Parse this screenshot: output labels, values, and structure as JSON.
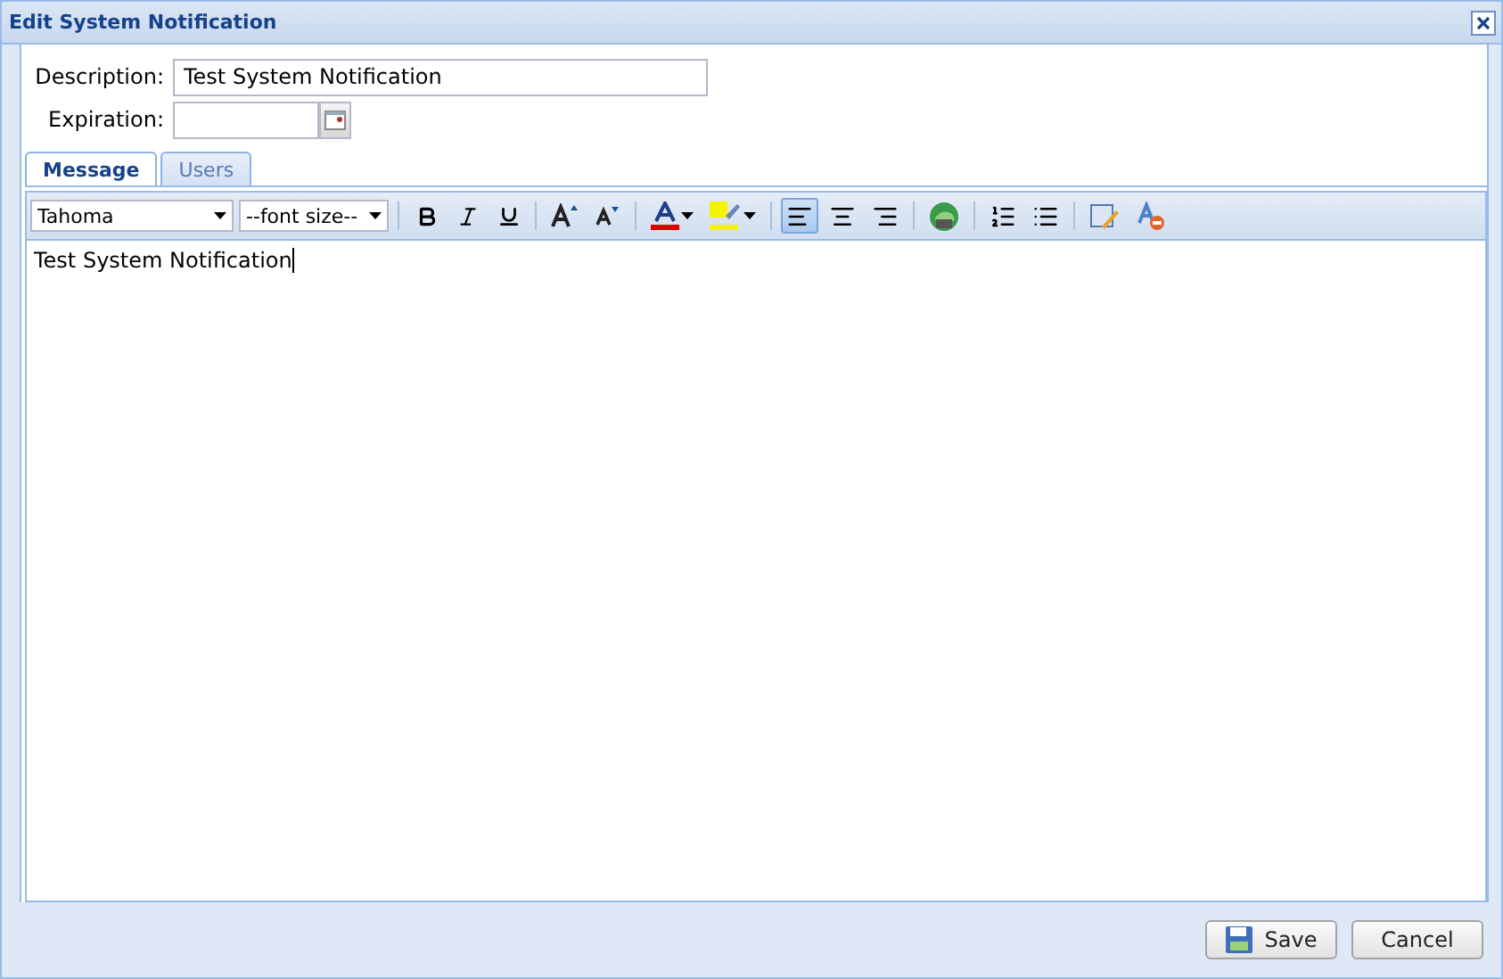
{
  "window": {
    "title": "Edit System Notification"
  },
  "fields": [
    {
      "label": "Description:",
      "value": "Test System Notification",
      "kind": "text"
    },
    {
      "label": "Expiration:",
      "kind": "date"
    }
  ],
  "tabs": [
    {
      "label": "Message",
      "selected": true
    },
    {
      "label": "Users",
      "selected": false
    }
  ],
  "toolbar": {
    "font": "Tahoma",
    "font_size": "--font size--",
    "alignment": [
      {
        "kind": "left",
        "selected": true
      },
      {
        "kind": "center",
        "selected": false
      },
      {
        "kind": "right",
        "selected": false
      }
    ]
  },
  "editor": {
    "text": "Test System Notification"
  },
  "buttons": [
    {
      "label": "Save",
      "kind": "save"
    },
    {
      "label": "Cancel",
      "kind": "cancel"
    }
  ]
}
